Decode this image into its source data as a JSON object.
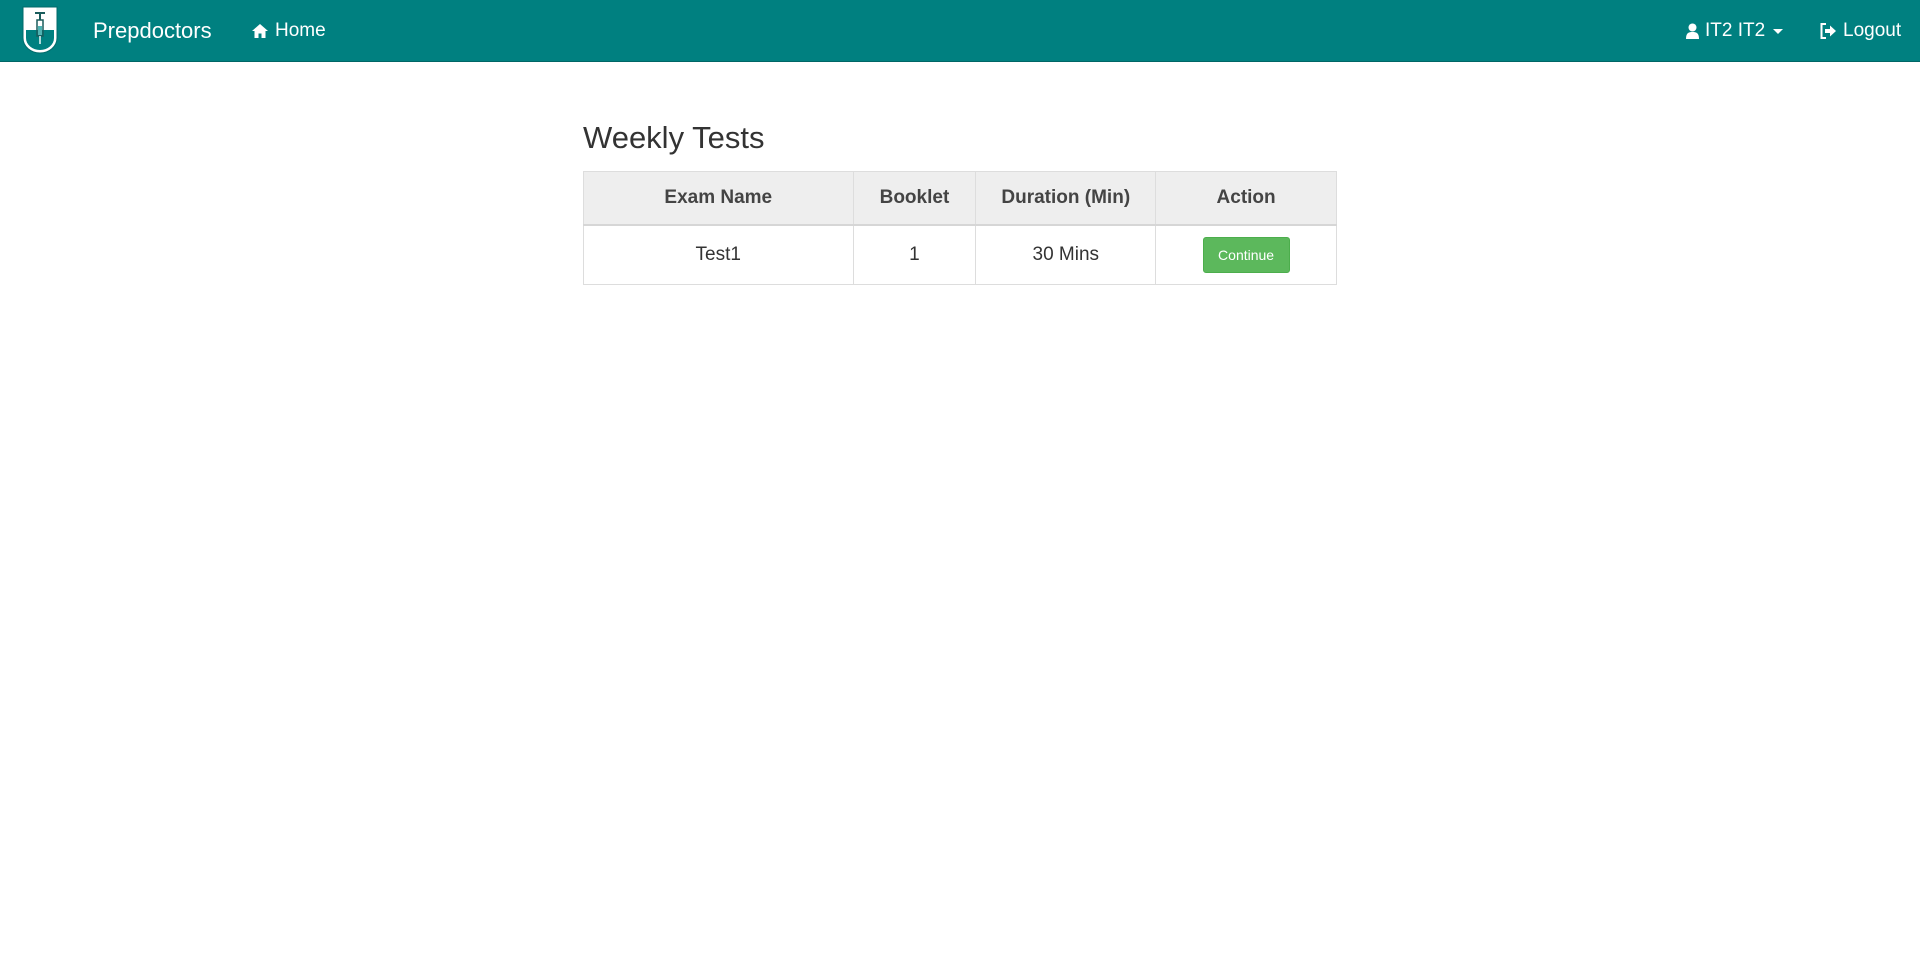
{
  "navbar": {
    "brand": "Prepdoctors",
    "home_label": "Home",
    "user_label": "IT2 IT2",
    "logout_label": "Logout",
    "background": "#008080"
  },
  "main": {
    "title": "Weekly Tests",
    "table": {
      "headers": [
        "Exam Name",
        "Booklet",
        "Duration (Min)",
        "Action"
      ],
      "rows": [
        {
          "exam_name": "Test1",
          "booklet": "1",
          "duration": "30 Mins",
          "action_label": "Continue"
        }
      ]
    }
  },
  "colors": {
    "accent": "#008080",
    "continue_button": "#5cb85c"
  }
}
